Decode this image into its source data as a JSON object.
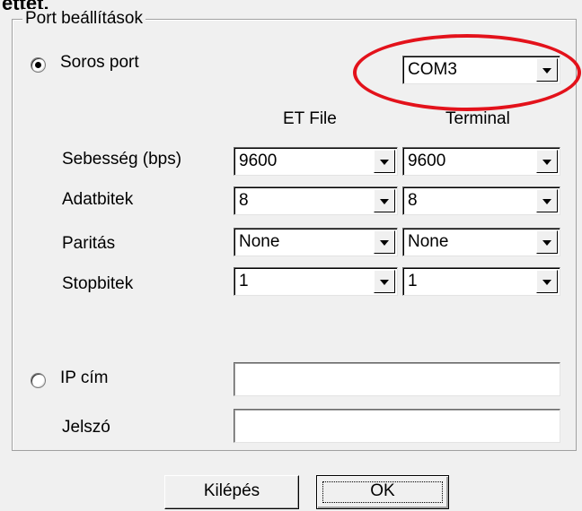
{
  "top_cut_text": "ettet.",
  "group_title": "Port beállítások",
  "serial": {
    "radio_label": "Soros port",
    "selected": true,
    "port_value": "COM3"
  },
  "columns": {
    "et_file": "ET File",
    "terminal": "Terminal"
  },
  "rows": [
    {
      "label": "Sebesség (bps)",
      "et_file": "9600",
      "terminal": "9600"
    },
    {
      "label": "Adatbitek",
      "et_file": "8",
      "terminal": "8"
    },
    {
      "label": "Paritás",
      "et_file": "None",
      "terminal": "None"
    },
    {
      "label": "Stopbitek",
      "et_file": "1",
      "terminal": "1"
    }
  ],
  "ip": {
    "radio_label": "IP cím",
    "selected": false,
    "address_value": "",
    "password_label": "Jelszó",
    "password_value": ""
  },
  "buttons": {
    "exit": "Kilépés",
    "ok": "OK"
  },
  "colors": {
    "highlight_ellipse": "#e3121b",
    "window_bg": "#f0f0f0"
  }
}
